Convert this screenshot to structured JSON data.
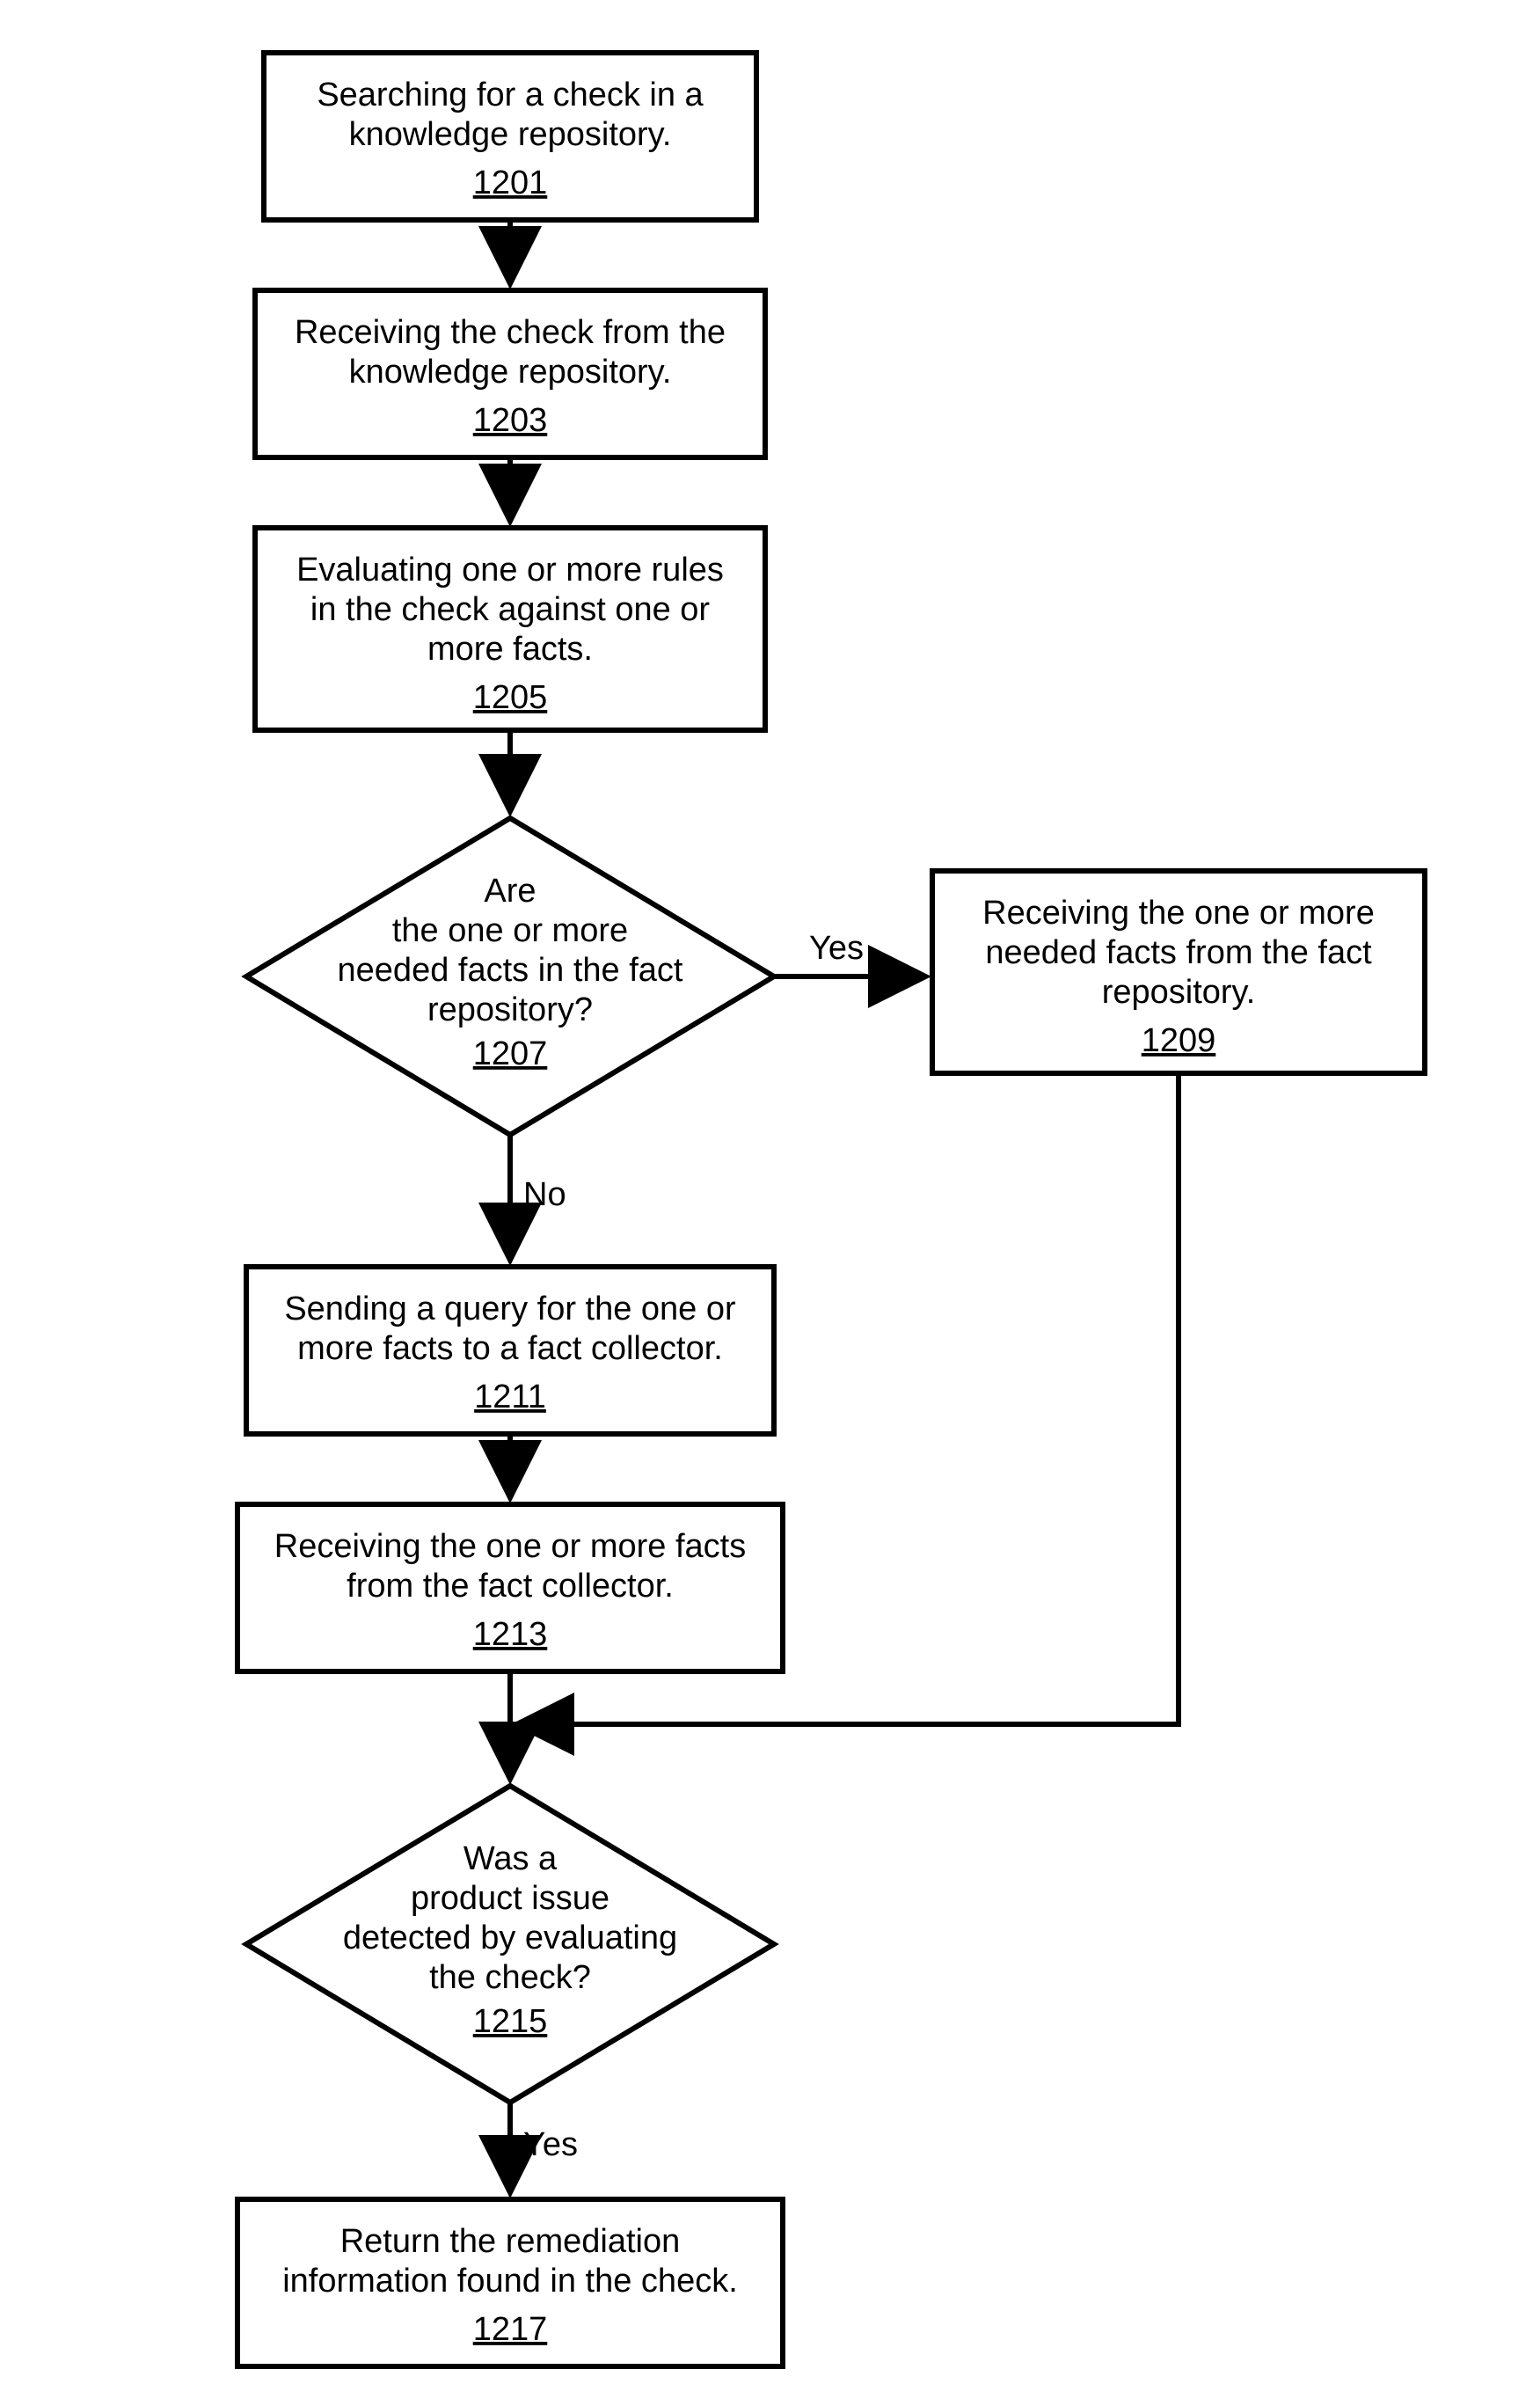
{
  "nodes": {
    "n1201": {
      "text": [
        "Searching for a check in a",
        "knowledge repository."
      ],
      "ref": "1201"
    },
    "n1203": {
      "text": [
        "Receiving the check from the",
        "knowledge repository."
      ],
      "ref": "1203"
    },
    "n1205": {
      "text": [
        "Evaluating one or more rules",
        "in the check against one or",
        "more facts."
      ],
      "ref": "1205"
    },
    "n1207": {
      "text": [
        "Are",
        "the one or more",
        "needed facts in the fact",
        "repository?"
      ],
      "ref": "1207"
    },
    "n1209": {
      "text": [
        "Receiving the one or more",
        "needed facts from the fact",
        "repository."
      ],
      "ref": "1209"
    },
    "n1211": {
      "text": [
        "Sending a query for the one or",
        "more facts to a fact collector."
      ],
      "ref": "1211"
    },
    "n1213": {
      "text": [
        "Receiving the one or more facts",
        "from the fact collector."
      ],
      "ref": "1213"
    },
    "n1215": {
      "text": [
        "Was a",
        "product issue",
        "detected by evaluating",
        "the check?"
      ],
      "ref": "1215"
    },
    "n1217": {
      "text": [
        "Return the remediation",
        "information found in the check."
      ],
      "ref": "1217"
    }
  },
  "edgeLabels": {
    "yes1": "Yes",
    "no1": "No",
    "yes2": "Yes"
  }
}
